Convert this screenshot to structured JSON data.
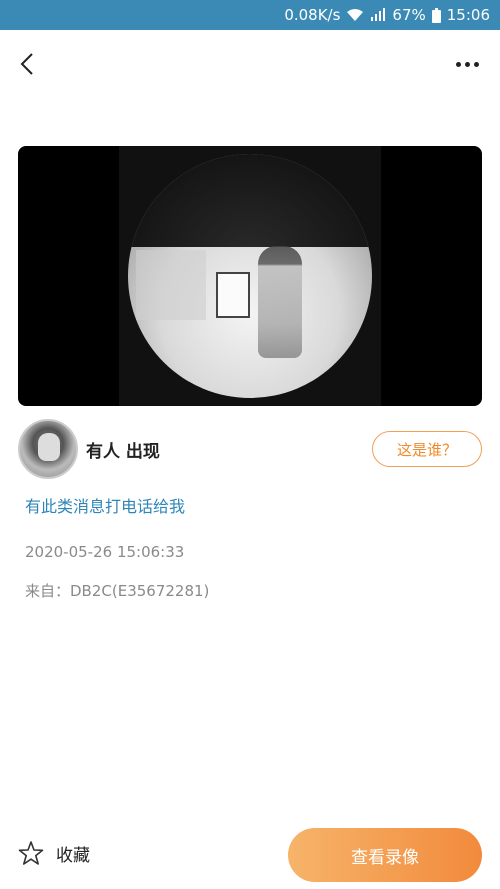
{
  "status_bar": {
    "speed": "0.08K/s",
    "battery": "67%",
    "time": "15:06",
    "background_color": "#3b8ab5"
  },
  "top_bar": {
    "back_icon": "chevron-left-icon",
    "more_icon": "more-horizontal-icon"
  },
  "event": {
    "title": "有人 出现",
    "who_button_label": "这是谁？",
    "call_link": "有此类消息打电话给我",
    "timestamp": "2020-05-26 15:06:33",
    "source": "来自：DB2C(E35672281)"
  },
  "bottom": {
    "favorite_label": "收藏",
    "favorite_icon": "star-outline-icon",
    "view_recording_label": "查看录像",
    "accent_color": "#f28a3c"
  }
}
